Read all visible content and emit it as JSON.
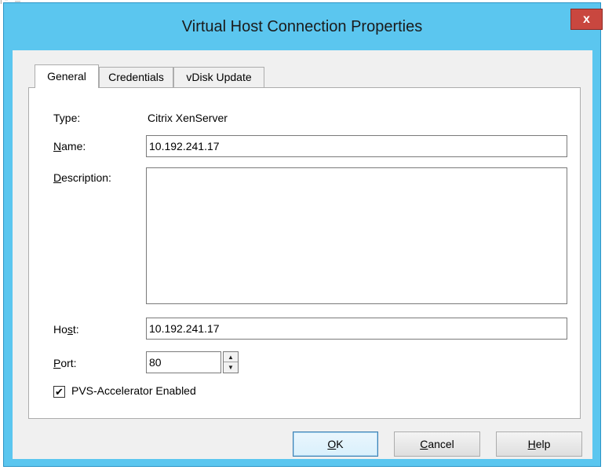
{
  "dialog": {
    "title": "Virtual Host Connection Properties",
    "close_glyph": "x"
  },
  "tabs": [
    {
      "label": "General",
      "active": true
    },
    {
      "label": "Credentials",
      "active": false
    },
    {
      "label": "vDisk Update",
      "active": false
    }
  ],
  "general": {
    "type_label": "Type:",
    "type_value": "Citrix XenServer",
    "name_label_u": "N",
    "name_label_rest": "ame:",
    "name_value": "10.192.241.17",
    "description_label_u": "D",
    "description_label_rest": "escription:",
    "description_value": "",
    "host_label_pre": "Ho",
    "host_label_u": "s",
    "host_label_rest": "t:",
    "host_value": "10.192.241.17",
    "port_label_u": "P",
    "port_label_rest": "ort:",
    "port_value": "80",
    "pvs_accelerator_label": "PVS-Accelerator Enabled",
    "pvs_accelerator_checked": true
  },
  "buttons": {
    "ok_u": "O",
    "ok_rest": "K",
    "cancel_u": "C",
    "cancel_rest": "ancel",
    "help_u": "H",
    "help_rest": "elp"
  },
  "colors": {
    "title_bar": "#5bc6ef",
    "close_button": "#c9473f"
  }
}
